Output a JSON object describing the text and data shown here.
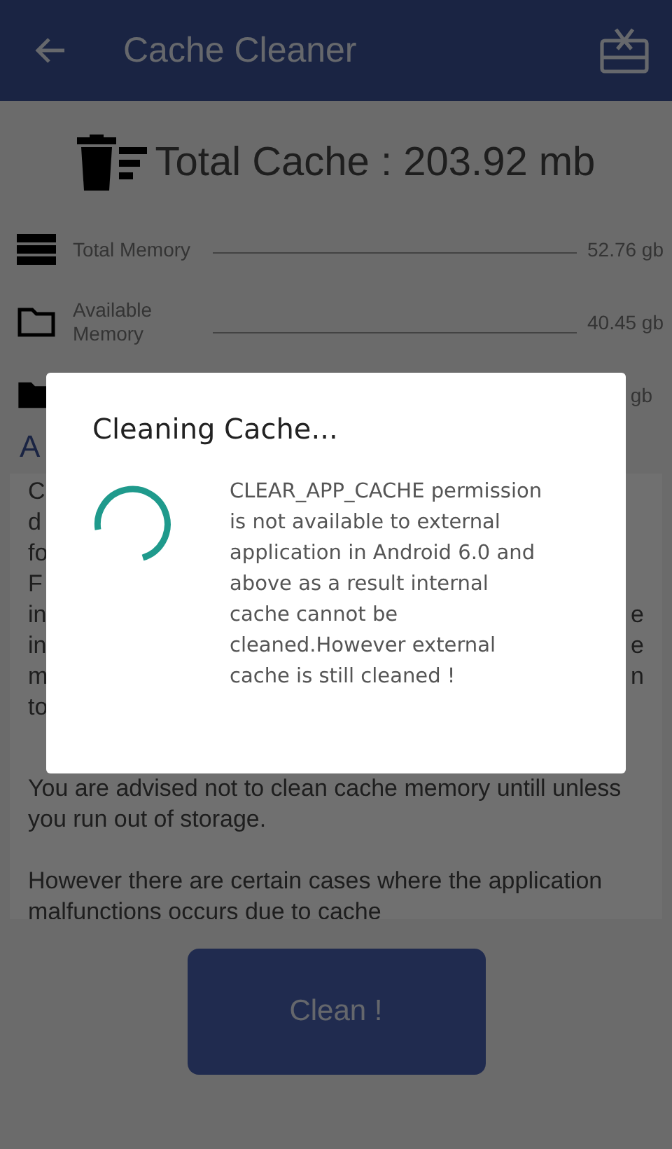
{
  "app_bar": {
    "title": "Cache Cleaner"
  },
  "total_cache": {
    "label": "Total Cache",
    "separator": ":",
    "value": "203.92 mb"
  },
  "memory_rows": [
    {
      "kind": "storage",
      "label": "Total Memory",
      "value": "52.76 gb"
    },
    {
      "kind": "folder_outline",
      "label": "Available Memory",
      "value": "40.45 gb"
    },
    {
      "kind": "folder_filled",
      "value": "gb"
    }
  ],
  "section_heading": "A",
  "info_lines_obscured": [
    {
      "left": "C"
    },
    {
      "left": "d"
    },
    {
      "left": "fo"
    },
    {
      "left": "F"
    },
    {
      "left": "in",
      "right": "e"
    },
    {
      "left": "in",
      "right": "e"
    },
    {
      "left": "m",
      "right": "n"
    },
    {
      "left": "to"
    }
  ],
  "info_paragraphs": [
    "You are advised not to clean cache memory untill unless you run out of storage.",
    "However there are certain cases where the application malfunctions occurs due to cache"
  ],
  "clean_button": "Clean !",
  "dialog": {
    "title": "Cleaning Cache...",
    "message": "CLEAR_APP_CACHE permission is not available to external application in Android 6.0 and above as a result internal cache cannot be cleaned.However external cache is still cleaned !"
  }
}
